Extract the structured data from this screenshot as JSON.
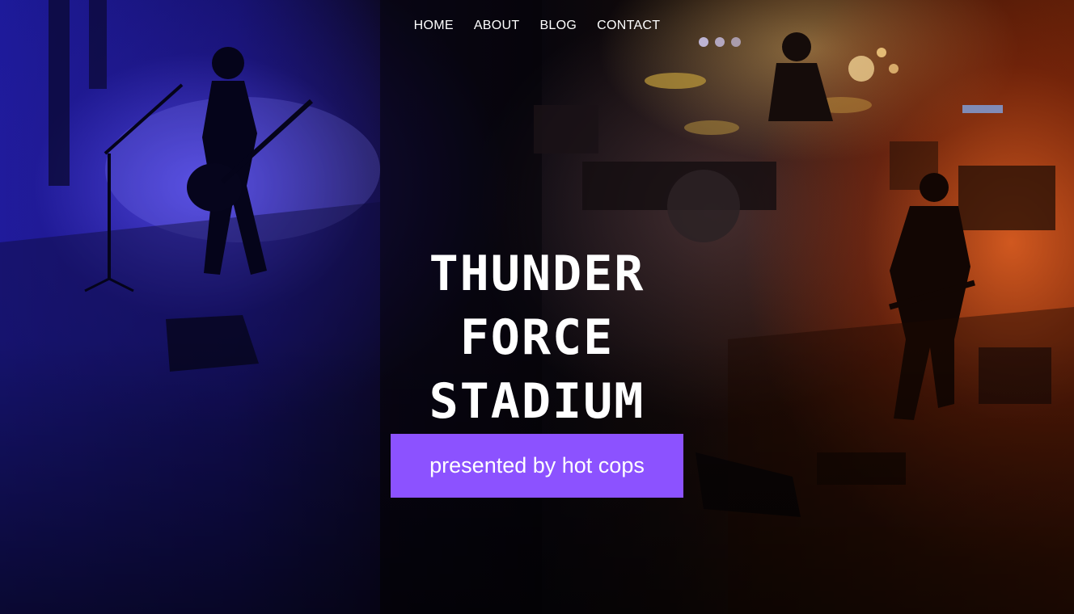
{
  "nav": {
    "items": [
      {
        "label": "HOME"
      },
      {
        "label": "ABOUT"
      },
      {
        "label": "BLOG"
      },
      {
        "label": "CONTACT"
      }
    ]
  },
  "hero": {
    "title_lines": [
      "THUNDER",
      "FORCE",
      "STADIUM"
    ],
    "cta_label": "presented by hot cops",
    "background_image": "concert-stage-photo",
    "colors": {
      "left_light": "#3a2fd6",
      "right_light": "#d0521a",
      "cta_bg": "#8c52ff",
      "text": "#ffffff"
    }
  }
}
